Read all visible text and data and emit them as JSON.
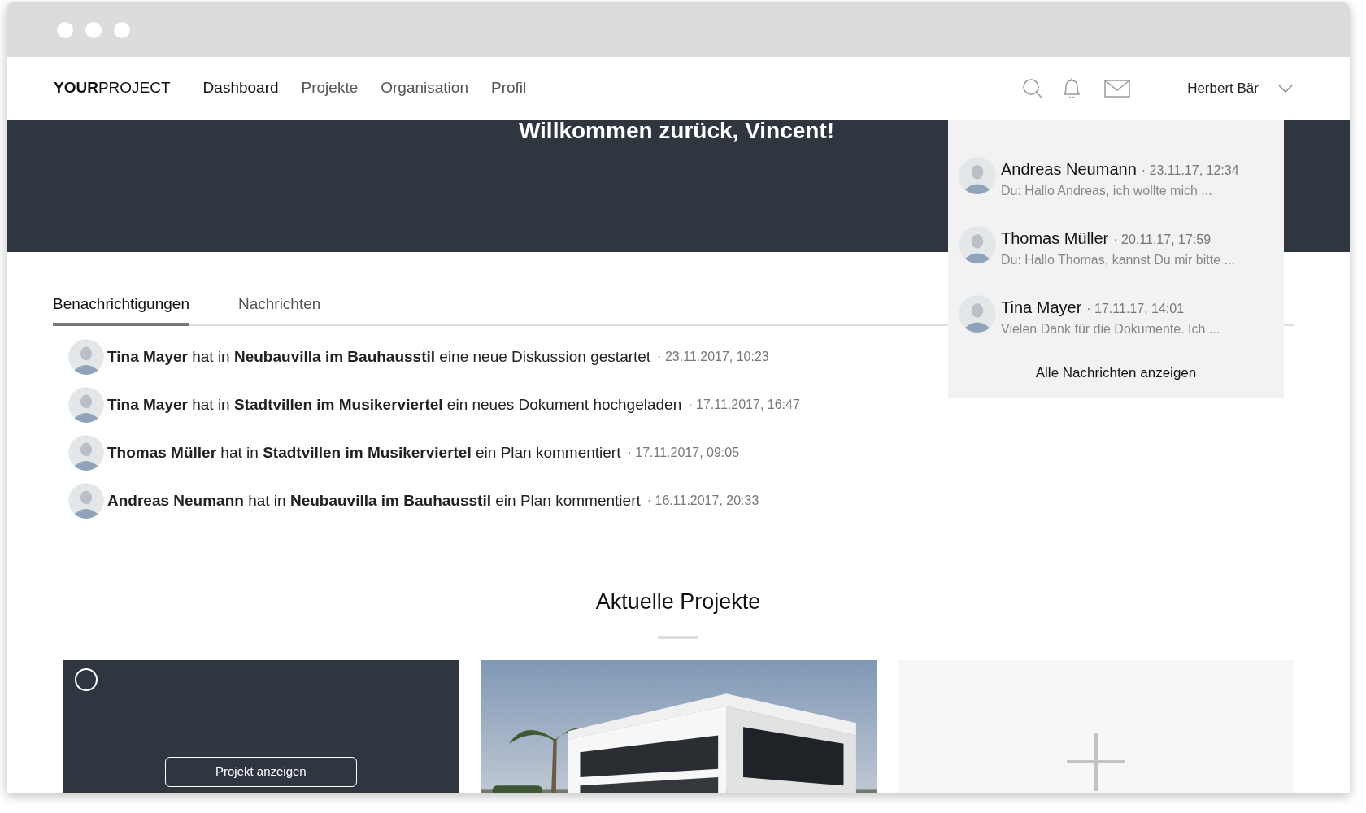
{
  "logo": {
    "bold": "YOUR",
    "light": "PROJECT"
  },
  "nav": [
    {
      "label": "Dashboard",
      "selected": true
    },
    {
      "label": "Projekte",
      "selected": false
    },
    {
      "label": "Organisation",
      "selected": false
    },
    {
      "label": "Profil",
      "selected": false
    }
  ],
  "user": {
    "name": "Herbert Bär"
  },
  "welcome": "Willkommen zurück, Vincent!",
  "tabs": [
    {
      "label": "Benachrichtigungen",
      "selected": true
    },
    {
      "label": "Nachrichten",
      "selected": false
    }
  ],
  "notifications": [
    {
      "text": "**Tina Mayer** hat in **Neubauvilla im Bauhausstil** eine neue Diskussion gestartet",
      "time": "· 23.11.2017, 10:23"
    },
    {
      "text": "**Tina Mayer** hat in **Stadtvillen im Musikerviertel** ein neues Dokument hochgeladen",
      "time": "· 17.11.2017, 16:47"
    },
    {
      "text": "**Thomas Müller** hat in **Stadtvillen im Musikerviertel** ein Plan kommentiert",
      "time": "· 17.11.2017, 09:05"
    },
    {
      "text": "**Andreas Neumann** hat in **Neubauvilla im Bauhausstil** ein Plan kommentiert",
      "time": "· 16.11.2017, 20:33"
    }
  ],
  "messages": {
    "items": [
      {
        "name": "Andreas Neumann",
        "time": "· 23.11.17, 12:34",
        "preview": "Du: Hallo Andreas, ich wollte mich ..."
      },
      {
        "name": "Thomas Müller",
        "time": "· 20.11.17, 17:59",
        "preview": "Du: Hallo Thomas, kannst Du mir bitte ..."
      },
      {
        "name": "Tina Mayer",
        "time": "· 17.11.17, 14:01",
        "preview": "Vielen Dank für die Dokumente. Ich ..."
      }
    ],
    "footer": "Alle Nachrichten anzeigen"
  },
  "projects": {
    "title": "Aktuelle Projekte",
    "cards": [
      {
        "kind": "dark",
        "button": "Projekt anzeigen"
      },
      {
        "kind": "picture"
      },
      {
        "kind": "add"
      }
    ]
  }
}
